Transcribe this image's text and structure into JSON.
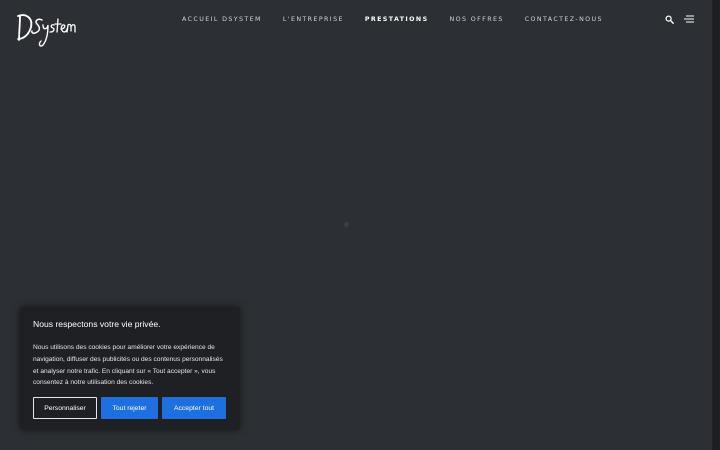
{
  "brand": {
    "logo_text": "DSystem"
  },
  "nav": {
    "items": [
      {
        "label": "ACCUEIL DSYSTEM",
        "active": false
      },
      {
        "label": "L'ENTREPRISE",
        "active": false
      },
      {
        "label": "PRESTATIONS",
        "active": true
      },
      {
        "label": "NOS OFFRES",
        "active": false
      },
      {
        "label": "CONTACTEZ-NOUS",
        "active": false
      }
    ]
  },
  "header_icons": {
    "search": "search-icon",
    "menu": "hamburger-menu-icon"
  },
  "cookie_banner": {
    "title": "Nous respectons votre vie privée.",
    "text": "Nous utilisons des cookies pour améliorer votre expérience de navigation, diffuser des publicités ou des contenus personnalisés et analyser notre trafic. En cliquant sur « Tout accepter », vous consentez à notre utilisation des cookies.",
    "customize_label": "Personnaliser",
    "reject_label": "Tout rejeter",
    "accept_label": "Accepter tout"
  },
  "colors": {
    "background": "#2c2f33",
    "banner_background": "#1e2023",
    "primary_button": "#1e6fe0",
    "text": "#ffffff"
  }
}
